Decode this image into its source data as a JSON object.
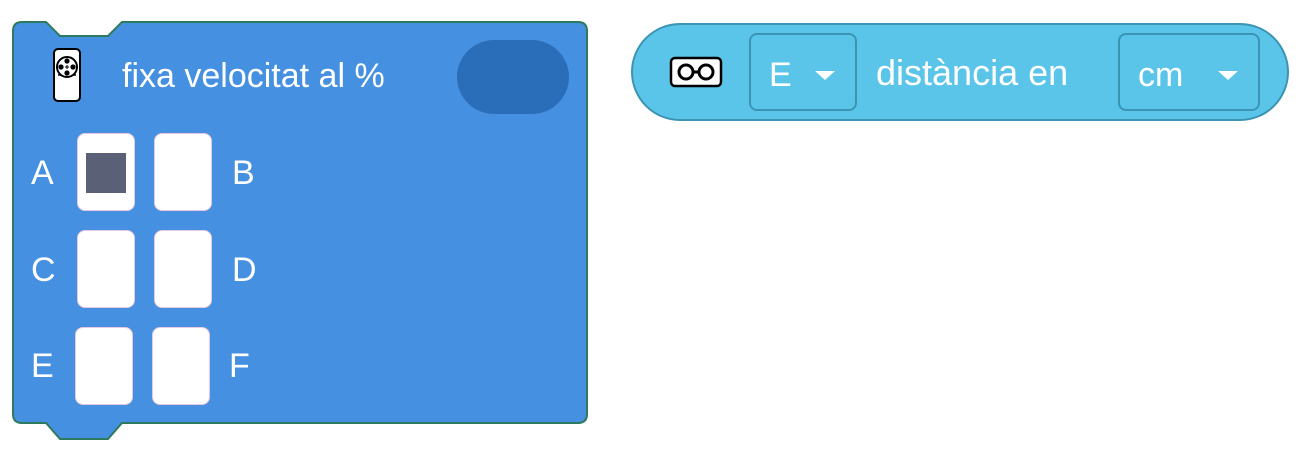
{
  "motor_block": {
    "icon": "motor-icon",
    "label": "fixa velocitat al %",
    "speed_value": "",
    "ports": [
      {
        "letter": "A",
        "selected": true
      },
      {
        "letter": "B",
        "selected": false
      },
      {
        "letter": "C",
        "selected": false
      },
      {
        "letter": "D",
        "selected": false
      },
      {
        "letter": "E",
        "selected": false
      },
      {
        "letter": "F",
        "selected": false
      }
    ],
    "colors": {
      "fill": "#4590e0",
      "stroke": "#2e7a5e",
      "input": "#2a6db8",
      "selected_port": "#5a6076"
    }
  },
  "distance_block": {
    "icon": "distance-sensor-icon",
    "port_value": "E",
    "label": "distància en",
    "unit_value": "cm",
    "colors": {
      "fill": "#5ac5e8",
      "stroke": "#3c94b4"
    }
  }
}
